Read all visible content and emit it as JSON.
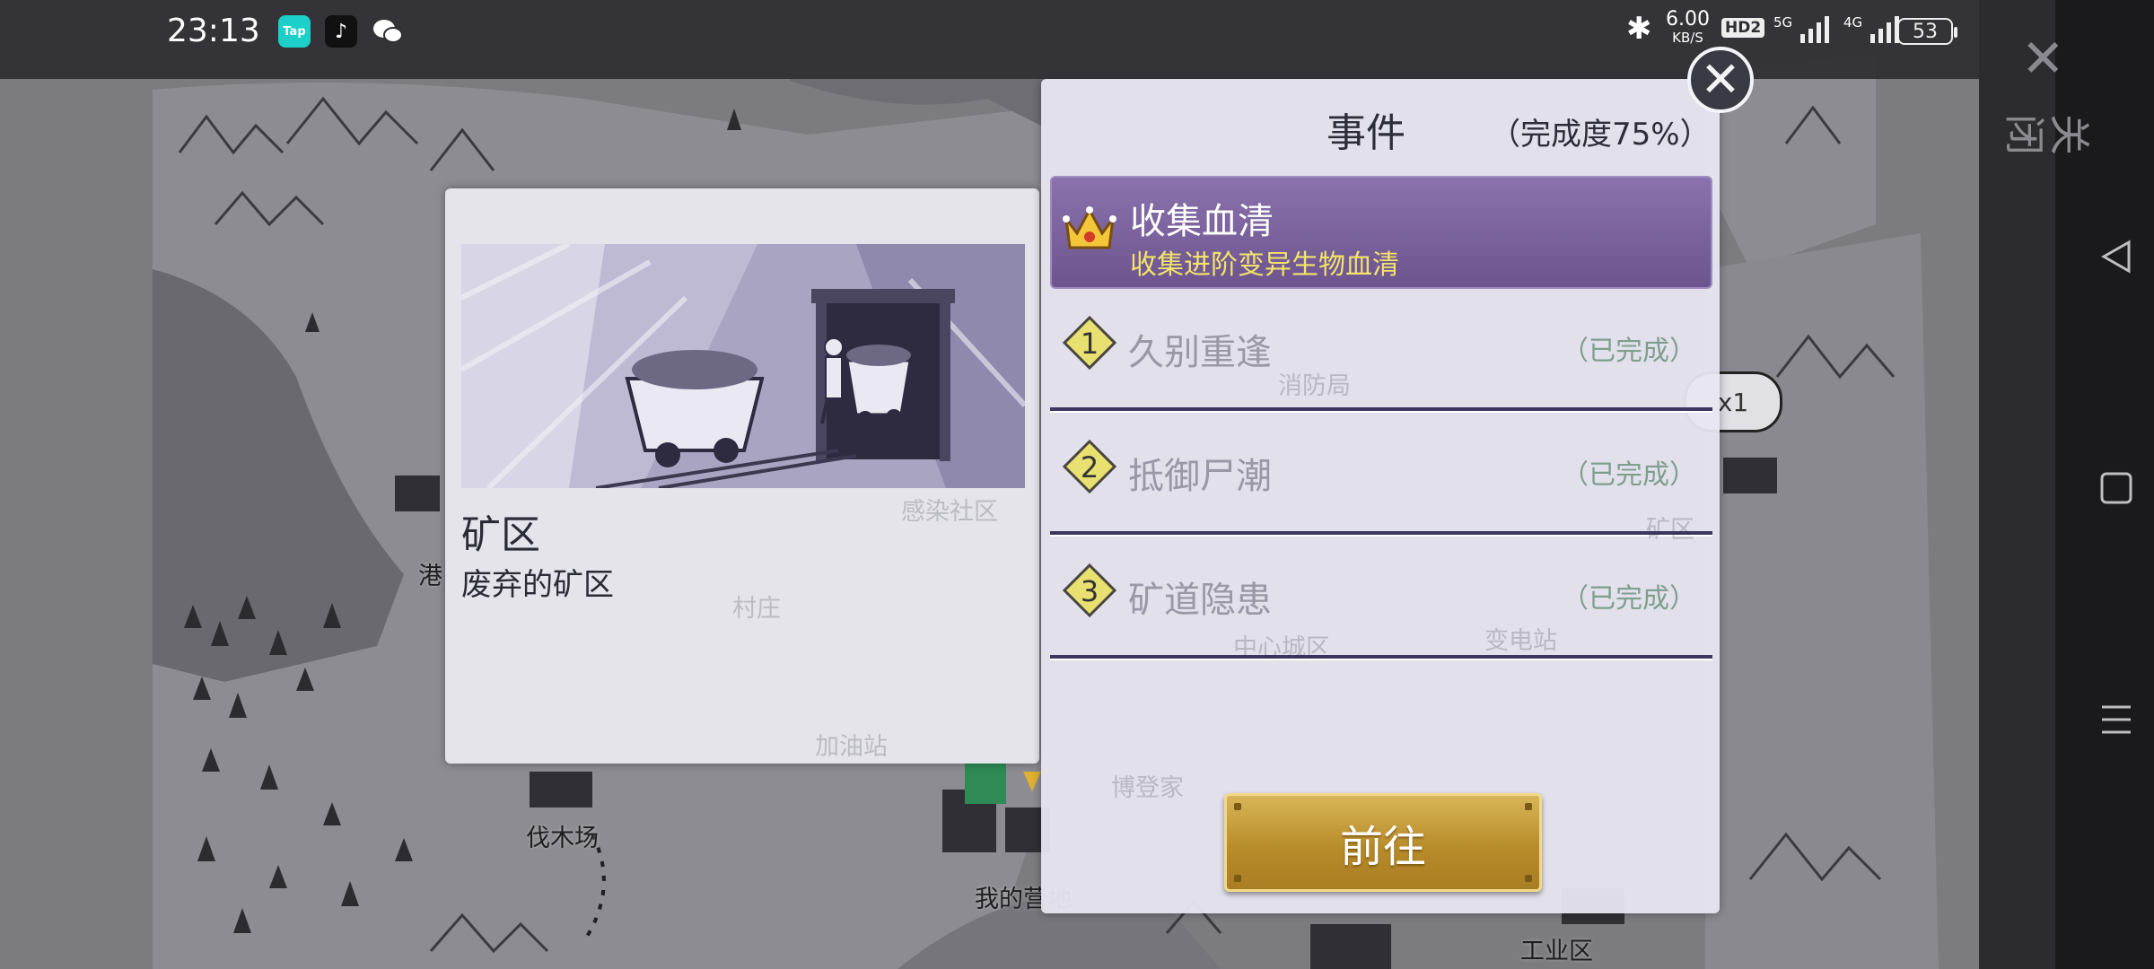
{
  "status_bar": {
    "time": "23:13",
    "apps": [
      {
        "name": "tap-app-icon",
        "label": "Tap",
        "color": "#1ccfc9"
      },
      {
        "name": "tiktok-app-icon",
        "label": "♪",
        "color": "#111111"
      },
      {
        "name": "wechat-app-icon",
        "label": "",
        "color": "#ffffff"
      }
    ],
    "net_speed": "6.00",
    "net_unit": "KB/S",
    "hd_badge": "HD2",
    "signal_5g": "5G",
    "signal_4g": "4G",
    "battery": "53"
  },
  "side_nav": {
    "close_label": "关闭",
    "icons": [
      "back-triangle-icon",
      "home-square-icon",
      "menu-lines-icon"
    ]
  },
  "map": {
    "labels": [
      {
        "name": "map-label-port",
        "text": "港"
      },
      {
        "name": "map-label-lumberyard",
        "text": "伐木场"
      },
      {
        "name": "map-label-my-base",
        "text": "我的营地"
      },
      {
        "name": "map-label-industrial",
        "text": "工业区"
      }
    ],
    "faded_labels": [
      {
        "name": "map-label-infected-community",
        "text": "感染社区"
      },
      {
        "name": "map-label-village",
        "text": "村庄"
      },
      {
        "name": "map-label-gas-station",
        "text": "加油站"
      },
      {
        "name": "map-label-doctor-home",
        "text": "博登家"
      },
      {
        "name": "map-label-fire-station",
        "text": "消防局"
      },
      {
        "name": "map-label-mine-zone",
        "text": "矿区"
      },
      {
        "name": "map-label-city-center",
        "text": "中心城区"
      },
      {
        "name": "map-label-power-station",
        "text": "变电站"
      }
    ],
    "pill_label": "x1"
  },
  "location_panel": {
    "title": "矿区",
    "description": "废弃的矿区"
  },
  "event_panel": {
    "title": "事件",
    "progress": "（完成度75%）",
    "active_event": {
      "name": "收集血清",
      "subtitle": "收集进阶变异生物血清"
    },
    "events": [
      {
        "number": "1",
        "name": "久别重逢",
        "status": "（已完成）"
      },
      {
        "number": "2",
        "name": "抵御尸潮",
        "status": "（已完成）"
      },
      {
        "number": "3",
        "name": "矿道隐患",
        "status": "（已完成）"
      }
    ],
    "goto_button": "前往"
  }
}
